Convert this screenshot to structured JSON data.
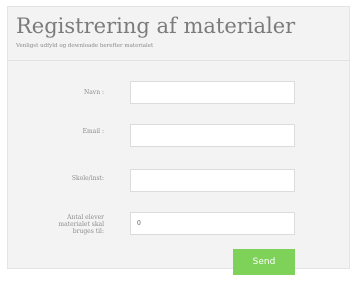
{
  "form": {
    "title": "Registrering af materialer",
    "subtitle": "Venligst udfyld og downloade herefter materialet",
    "fields": [
      {
        "label": "Navn :",
        "value": ""
      },
      {
        "label": "Email :",
        "value": ""
      },
      {
        "label": "Skole/inst:",
        "value": ""
      },
      {
        "label_lines": [
          "Antal elever",
          "materialet skal",
          "bruges til:"
        ],
        "value": "0"
      }
    ],
    "submit_label": "Send"
  },
  "colors": {
    "panel_background": "#f3f3f3",
    "title_text": "#7b7b7b",
    "button_background": "#7ed25a",
    "button_text": "#ffffff"
  }
}
